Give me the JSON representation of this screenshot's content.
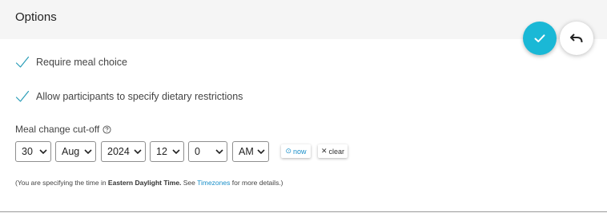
{
  "header": {
    "title": "Options"
  },
  "actions": {
    "confirm_icon": "checkmark-icon",
    "undo_icon": "undo-icon",
    "accent_color": "#1ab8d6"
  },
  "options": [
    {
      "label": "Require meal choice",
      "checked": true
    },
    {
      "label": "Allow participants to specify dietary restrictions",
      "checked": true
    }
  ],
  "cutoff": {
    "label": "Meal change cut-off",
    "day": "30",
    "month": "Aug",
    "year": "2024",
    "hour": "12",
    "minute": "0",
    "ampm": "AM",
    "now_label": "now",
    "clear_label": "clear"
  },
  "footnote": {
    "prefix": "(You are specifying the time in ",
    "timezone": "Eastern Daylight Time.",
    "middle": " See ",
    "link": "Timezones",
    "suffix": " for more details.)"
  }
}
